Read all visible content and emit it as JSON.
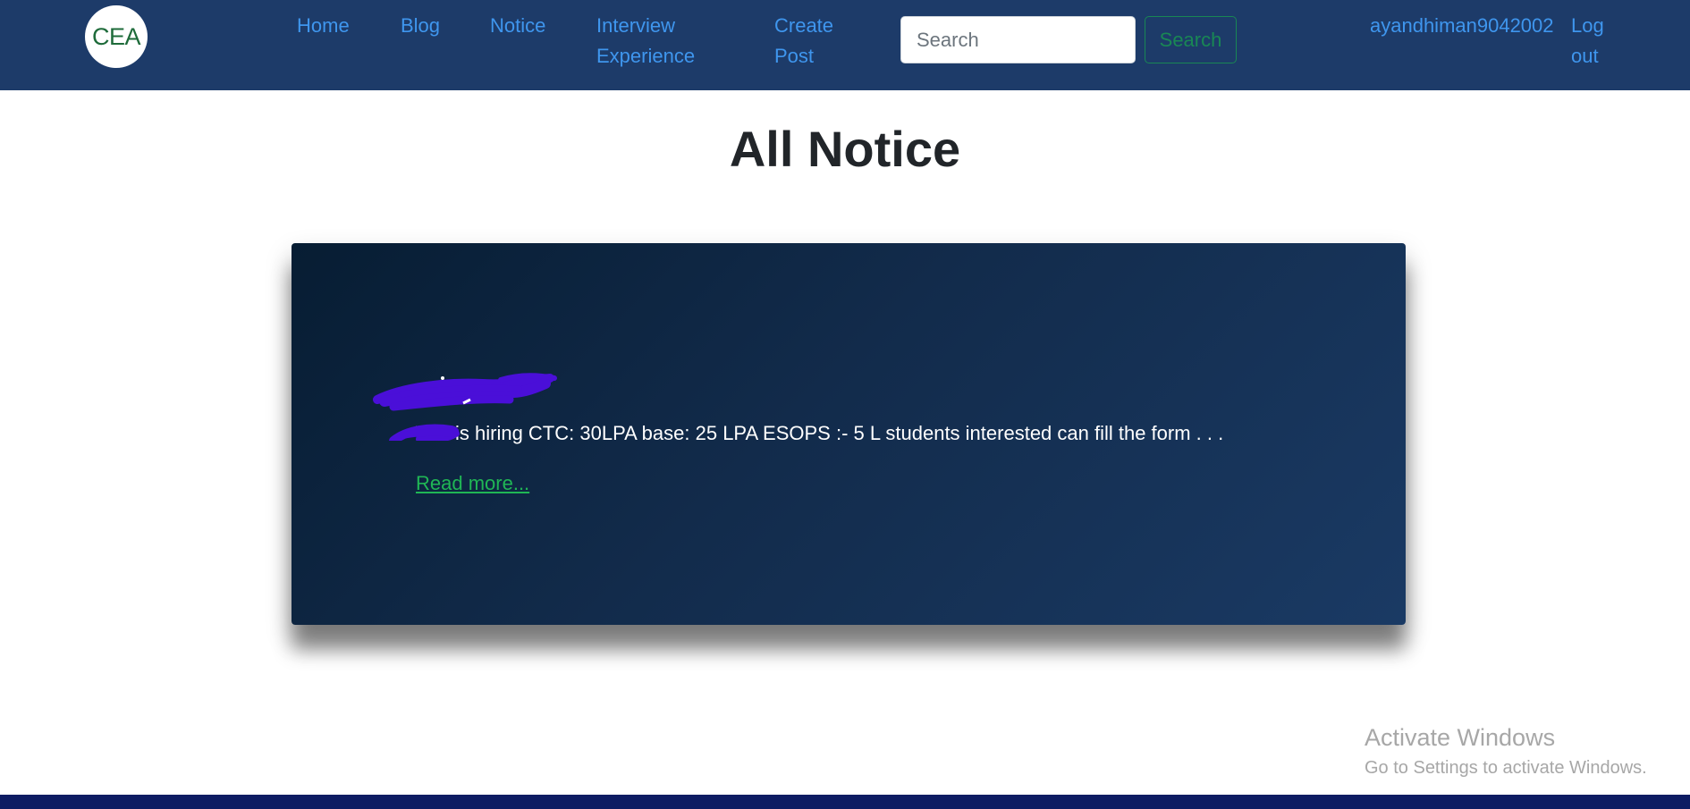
{
  "nav": {
    "logo_text": "CEA",
    "links": [
      "Home",
      "Blog",
      "Notice",
      "Interview Experience",
      "Create Post"
    ],
    "search": {
      "placeholder": "Search",
      "value": "",
      "button_label": "Search"
    },
    "username": "ayandhiman9042002",
    "logout_label": "Log out"
  },
  "main": {
    "title": "All Notice",
    "notices": [
      {
        "title": "",
        "body": "W... is hiring CTC: 30LPA base: 25 LPA ESOPS :- 5 L students interested can fill the form . . .",
        "read_more": "Read more..."
      }
    ]
  },
  "watermark": {
    "title": "Activate Windows",
    "subtitle": "Go to Settings to activate Windows."
  },
  "colors": {
    "navbar": "#1d3b69",
    "link": "#3f96ee",
    "success": "#198754",
    "card_start": "#071d33",
    "card_end": "#1a3a64",
    "read_more": "#20b655",
    "footer": "#0d1c63",
    "scribble": "#4a0fd8"
  }
}
